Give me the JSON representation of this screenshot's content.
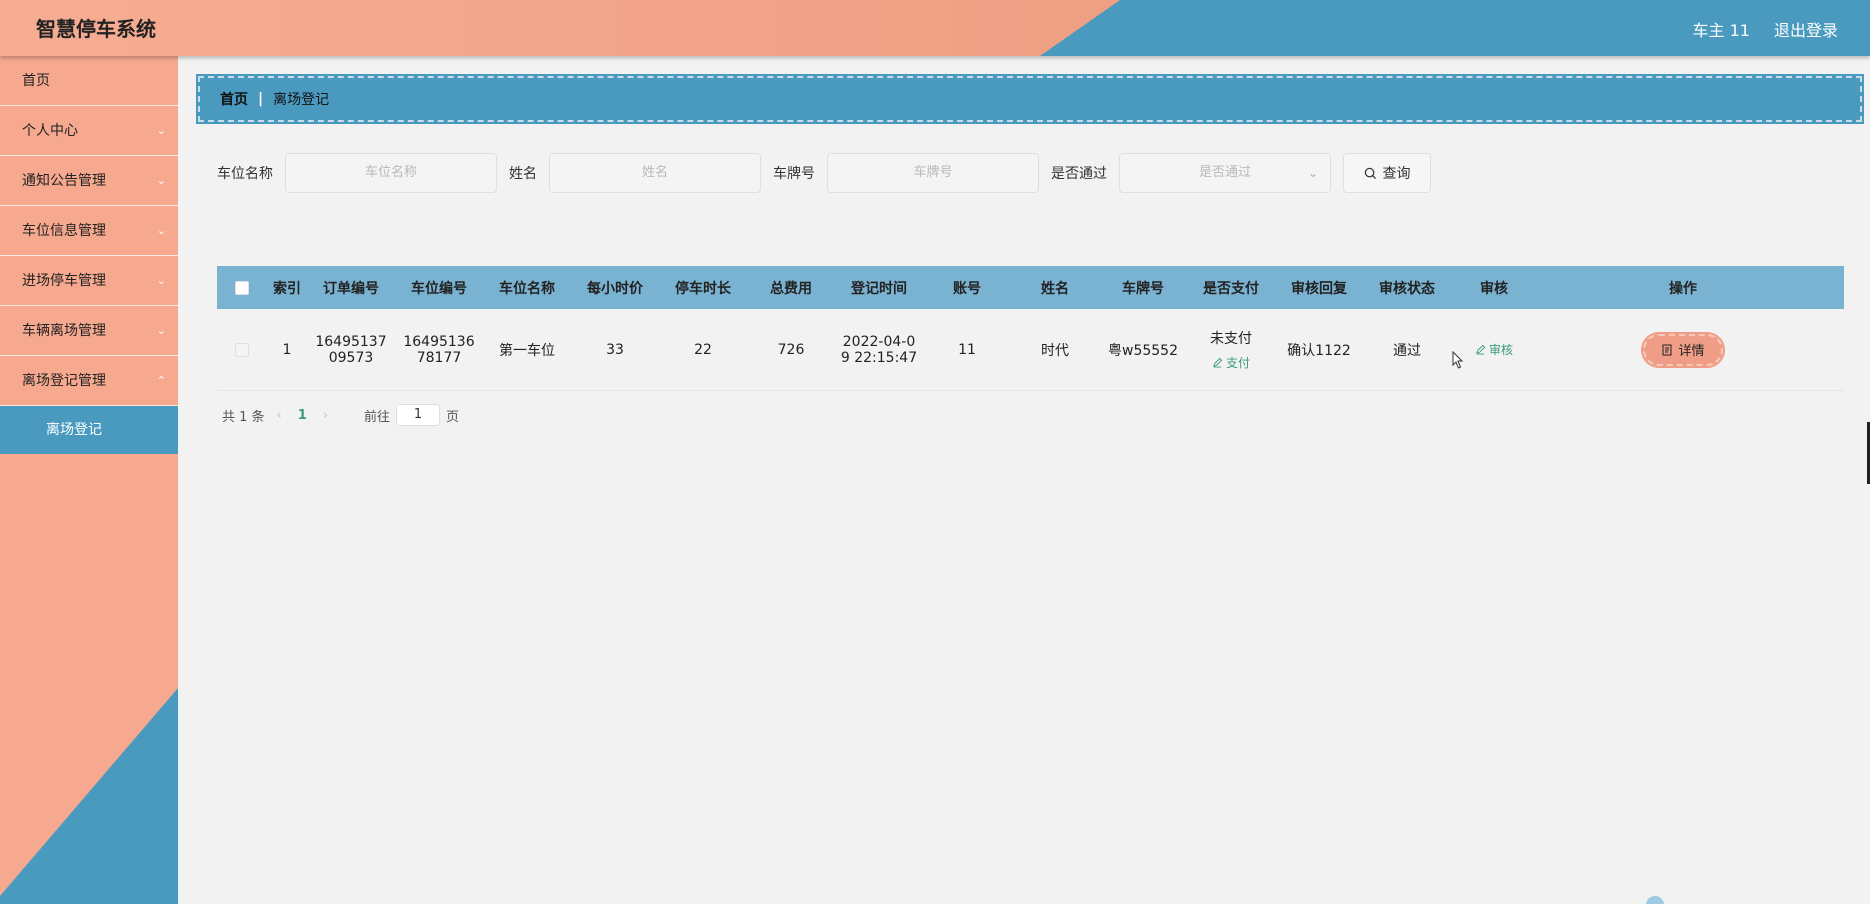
{
  "app": {
    "title": "智慧停车系统",
    "user": "车主 11",
    "logout": "退出登录"
  },
  "sidebar": {
    "items": [
      {
        "label": "首页",
        "has_children": false
      },
      {
        "label": "个人中心",
        "has_children": true
      },
      {
        "label": "通知公告管理",
        "has_children": true
      },
      {
        "label": "车位信息管理",
        "has_children": true
      },
      {
        "label": "进场停车管理",
        "has_children": true
      },
      {
        "label": "车辆离场管理",
        "has_children": true
      },
      {
        "label": "离场登记管理",
        "has_children": true
      }
    ],
    "active_sub": "离场登记"
  },
  "breadcrumb": {
    "home": "首页",
    "separator": "|",
    "current": "离场登记"
  },
  "search": {
    "space_name_label": "车位名称",
    "space_name_placeholder": "车位名称",
    "name_label": "姓名",
    "name_placeholder": "姓名",
    "plate_label": "车牌号",
    "plate_placeholder": "车牌号",
    "approved_label": "是否通过",
    "approved_placeholder": "是否通过",
    "query_button": "查询"
  },
  "table": {
    "columns": [
      "索引",
      "订单编号",
      "车位编号",
      "车位名称",
      "每小时价",
      "停车时长",
      "总费用",
      "登记时间",
      "账号",
      "姓名",
      "车牌号",
      "是否支付",
      "审核回复",
      "审核状态",
      "审核",
      "操作"
    ],
    "rows": [
      {
        "index": "1",
        "order_no": "1649513709573",
        "order_no_l1": "16495137",
        "order_no_l2": "09573",
        "space_no_l1": "16495136",
        "space_no_l2": "78177",
        "space_name": "第一车位",
        "hourly_price": "33",
        "duration": "22",
        "total": "726",
        "time_l1": "2022-04-0",
        "time_l2": "9 22:15:47",
        "account": "11",
        "name": "时代",
        "plate": "粤w55552",
        "paid_status": "未支付",
        "pay_action": "支付",
        "reply": "确认1122",
        "audit_status": "通过",
        "audit_action": "审核",
        "detail_action": "详情"
      }
    ]
  },
  "pagination": {
    "total": "共 1 条",
    "current_page": "1",
    "goto_label": "前往",
    "goto_value": "1",
    "page_suffix": "页"
  },
  "colors": {
    "salmon": "#f6a98f",
    "blue": "#4a9ac0",
    "table_header": "#7ab2d1",
    "green_link": "#3a9a7a"
  }
}
